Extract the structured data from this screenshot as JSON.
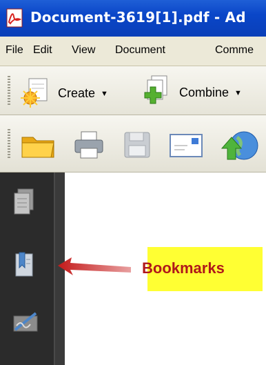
{
  "window": {
    "title": "Document-3619[1].pdf - Ad"
  },
  "menu": {
    "items": [
      "File",
      "Edit",
      "View",
      "Document",
      "Comme"
    ]
  },
  "toolbar1": {
    "create_label": "Create",
    "combine_label": "Combine"
  },
  "toolbar2": {
    "icons": [
      "open-folder-icon",
      "print-icon",
      "save-icon",
      "email-icon",
      "upload-globe-icon"
    ]
  },
  "nav_panel": {
    "icons": [
      "pages-icon",
      "bookmarks-icon",
      "signatures-icon"
    ]
  },
  "annotation": {
    "label": "Bookmarks"
  },
  "colors": {
    "title_bar": "#0a46c8",
    "annotation_fill": "#ffff33",
    "annotation_text": "#b0181a",
    "arrow": "#c41a1a",
    "nav_panel": "#2b2b2b"
  }
}
